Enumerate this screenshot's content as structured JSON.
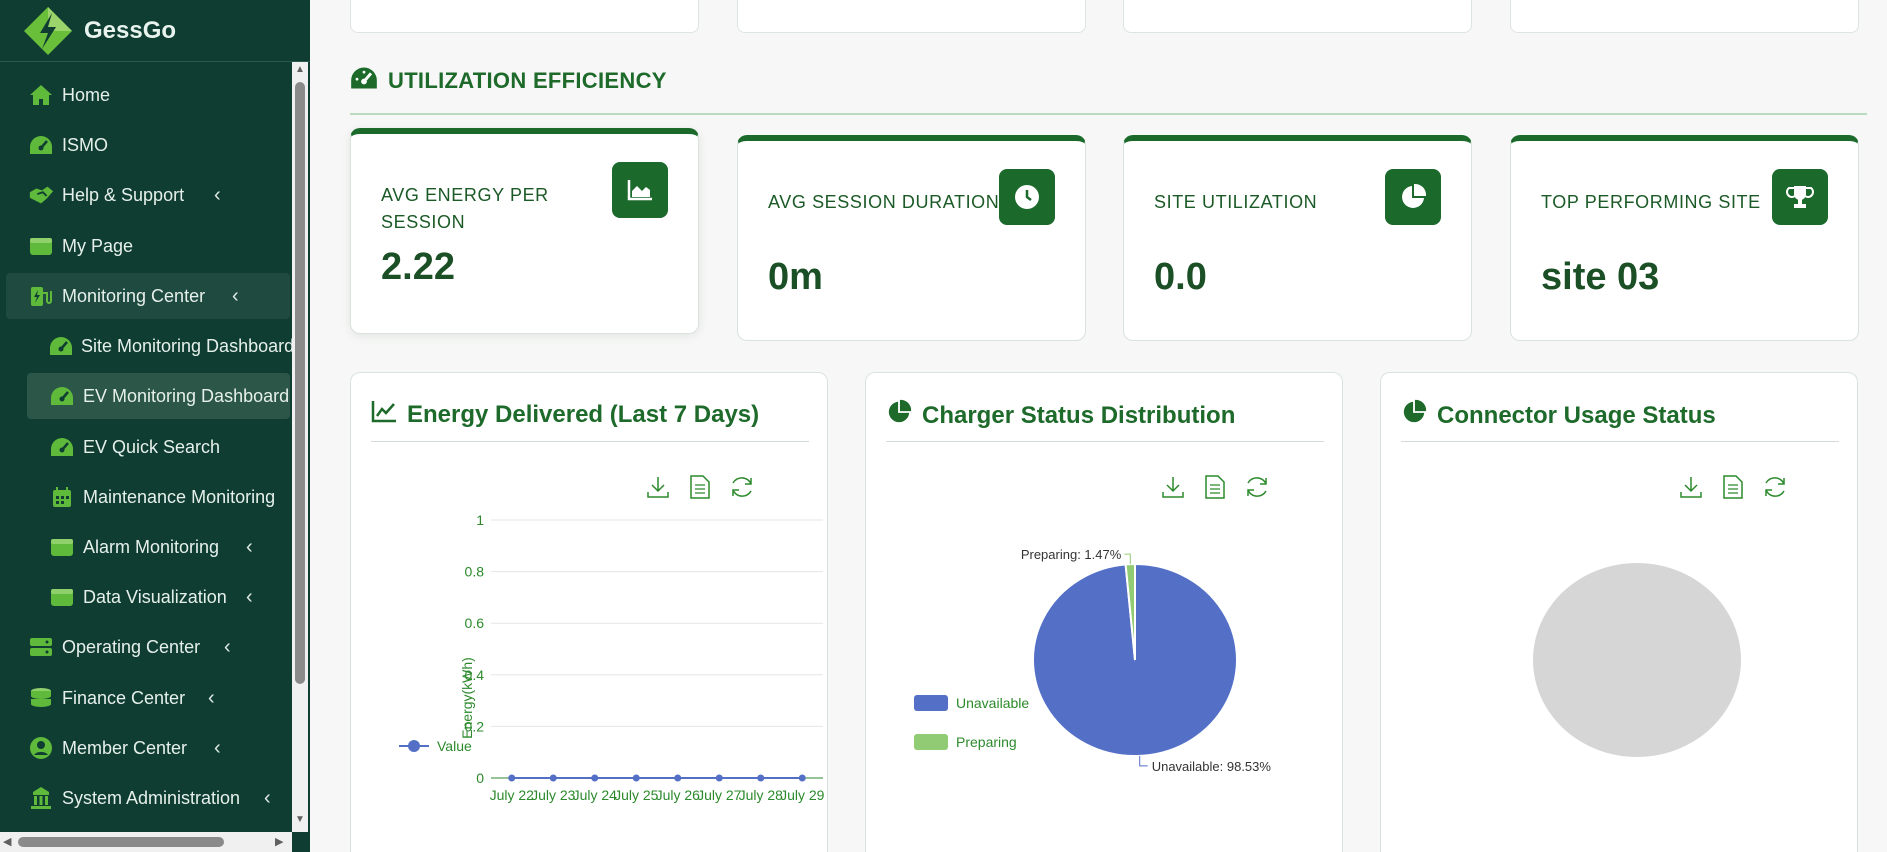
{
  "brand": {
    "name": "GessGo"
  },
  "sidebar": {
    "items": [
      {
        "label": "Home",
        "icon": "home-icon"
      },
      {
        "label": "ISMO",
        "icon": "gauge-icon"
      },
      {
        "label": "Help & Support",
        "icon": "handshake-icon"
      },
      {
        "label": "My Page",
        "icon": "wallet-icon"
      },
      {
        "label": "Monitoring Center",
        "icon": "ev-charger-icon"
      },
      {
        "label": "Site Monitoring Dashboard",
        "icon": "gauge-icon"
      },
      {
        "label": "EV Monitoring Dashboard",
        "icon": "gauge-icon"
      },
      {
        "label": "EV Quick Search",
        "icon": "gauge-icon"
      },
      {
        "label": "Maintenance Monitoring",
        "icon": "calendar-icon"
      },
      {
        "label": "Alarm Monitoring",
        "icon": "wallet-icon"
      },
      {
        "label": "Data Visualization",
        "icon": "wallet-icon"
      },
      {
        "label": "Operating Center",
        "icon": "server-icon"
      },
      {
        "label": "Finance Center",
        "icon": "coins-icon"
      },
      {
        "label": "Member Center",
        "icon": "user-circle-icon"
      },
      {
        "label": "System Administration",
        "icon": "building-icon"
      }
    ]
  },
  "section": {
    "title": "UTILIZATION EFFICIENCY"
  },
  "kpis": [
    {
      "label": "AVG ENERGY PER SESSION",
      "value": "2.22",
      "icon": "area-chart-icon"
    },
    {
      "label": "AVG SESSION DURATION",
      "value": "0m",
      "icon": "clock-icon"
    },
    {
      "label": "SITE UTILIZATION",
      "value": "0.0",
      "icon": "pie-chart-icon"
    },
    {
      "label": "TOP PERFORMING SITE",
      "value": "site 03",
      "icon": "trophy-icon"
    }
  ],
  "panels": {
    "energy": {
      "title": "Energy Delivered (Last 7 Days)"
    },
    "charger": {
      "title": "Charger Status Distribution"
    },
    "connector": {
      "title": "Connector Usage Status"
    }
  },
  "colors": {
    "brand": "#1b6a2c",
    "sidebar": "#0f3d32",
    "unavailable": "#5470c6",
    "preparing": "#91cc75"
  },
  "chart_data": [
    {
      "type": "line",
      "title": "Energy Delivered (Last 7 Days)",
      "ylabel": "Energy(kWh)",
      "x": [
        "July 22",
        "July 23",
        "July 24",
        "July 25",
        "July 26",
        "July 27",
        "July 28",
        "July 29"
      ],
      "series": [
        {
          "name": "Value",
          "values": [
            0,
            0,
            0,
            0,
            0,
            0,
            0,
            0
          ]
        }
      ],
      "ylim": [
        0,
        1
      ],
      "yticks": [
        "0",
        "0.2",
        "0.4",
        "0.6",
        "0.8",
        "1"
      ],
      "grid": true,
      "legend": "left"
    },
    {
      "type": "pie",
      "title": "Charger Status Distribution",
      "categories": [
        "Unavailable",
        "Preparing"
      ],
      "values": [
        98.53,
        1.47
      ],
      "labels": [
        "Unavailable: 98.53%",
        "Preparing: 1.47%"
      ],
      "legend": "left"
    },
    {
      "type": "pie",
      "title": "Connector Usage Status",
      "categories": [],
      "values": []
    }
  ]
}
